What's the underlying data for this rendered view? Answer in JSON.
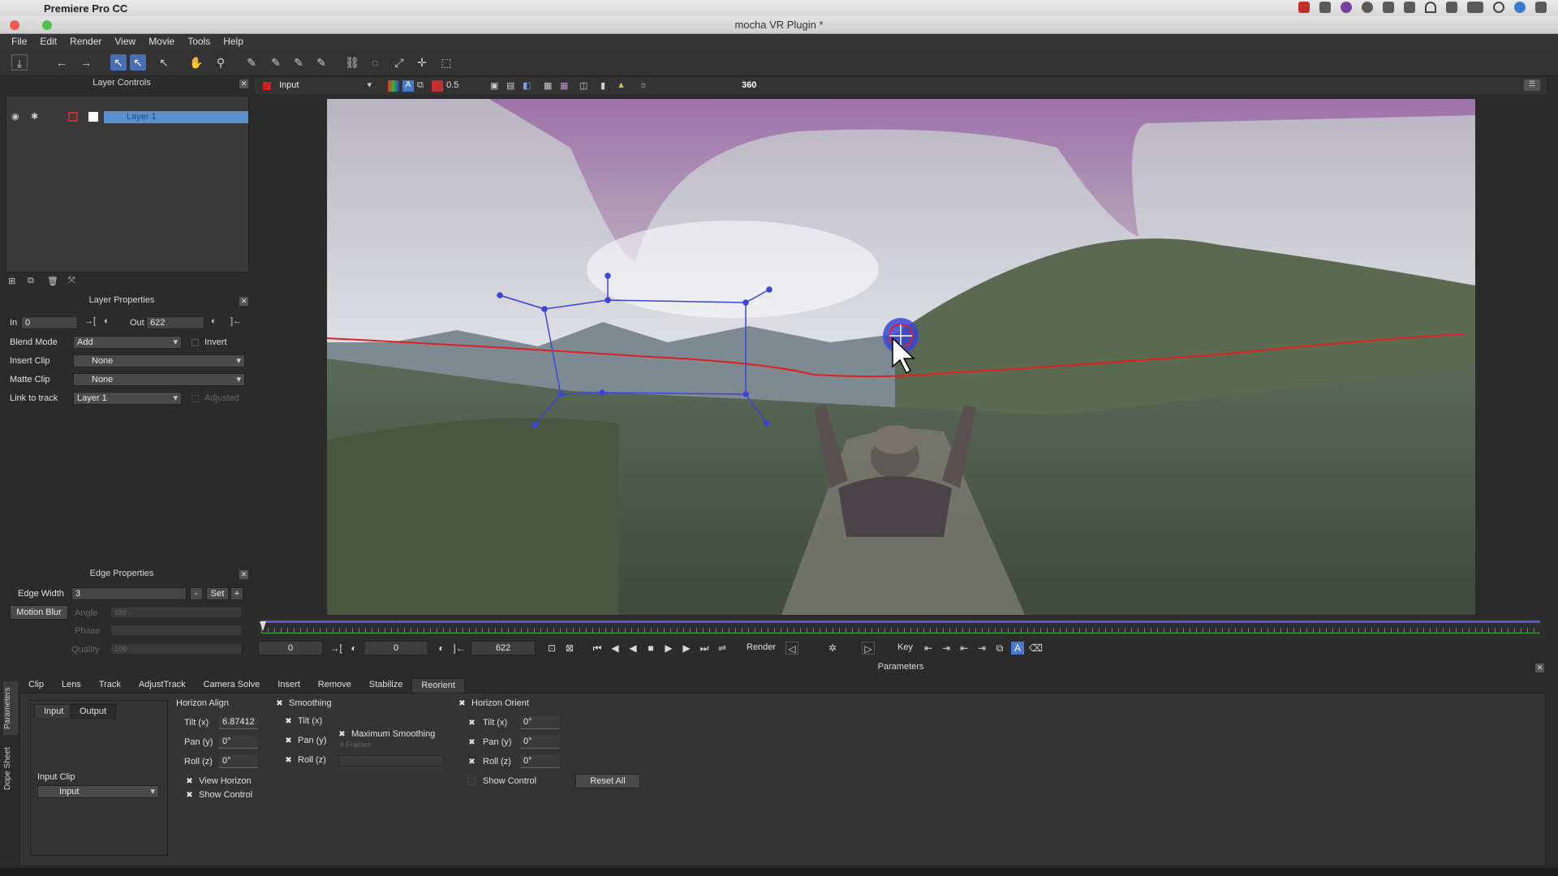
{
  "mac_menubar": {
    "app_name": "Premiere Pro CC"
  },
  "window": {
    "title": "mocha VR Plugin *"
  },
  "menu": [
    "File",
    "Edit",
    "Render",
    "View",
    "Movie",
    "Tools",
    "Help"
  ],
  "viewer_bar": {
    "clip": "Input",
    "zoom": "0.5",
    "mode": "360"
  },
  "layer_controls": {
    "title": "Layer Controls",
    "layers": [
      {
        "name": "Layer 1"
      }
    ]
  },
  "layer_properties": {
    "title": "Layer Properties",
    "in_label": "In",
    "in_value": "0",
    "out_label": "Out",
    "out_value": "622",
    "blend_mode_label": "Blend Mode",
    "blend_mode_value": "Add",
    "invert_label": "Invert",
    "insert_clip_label": "Insert Clip",
    "insert_clip_value": "None",
    "matte_clip_label": "Matte Clip",
    "matte_clip_value": "None",
    "link_to_track_label": "Link to track",
    "link_to_track_value": "Layer 1",
    "adjusted_label": "Adjusted"
  },
  "edge_properties": {
    "title": "Edge Properties",
    "edge_width_label": "Edge Width",
    "edge_width_value": "3",
    "minus": "-",
    "set": "Set",
    "plus": "+",
    "motion_blur_label": "Motion Blur",
    "angle_label": "Angle",
    "angle_value": "180",
    "phase_label": "Phase",
    "quality_label": "Quality",
    "quality_value": "100"
  },
  "transport": {
    "start": "0",
    "current": "0",
    "end": "622",
    "render_label": "Render",
    "key_label": "Key"
  },
  "parameters": {
    "title": "Parameters",
    "side_tabs": [
      "Parameters",
      "Dope Sheet"
    ],
    "tabs": [
      "Clip",
      "Lens",
      "Track",
      "AdjustTrack",
      "Camera Solve",
      "Insert",
      "Remove",
      "Stabilize",
      "Reorient"
    ],
    "io_tabs": [
      "Input",
      "Output"
    ],
    "input_clip_label": "Input Clip",
    "input_clip_value": "Input",
    "horizon_align": {
      "title": "Horizon Align",
      "tilt_label": "Tilt (x)",
      "tilt_value": "6.87412",
      "pan_label": "Pan (y)",
      "pan_value": "0°",
      "roll_label": "Roll (z)",
      "roll_value": "0°",
      "view_horizon": "View Horizon",
      "show_control": "Show Control"
    },
    "smoothing": {
      "title": "Smoothing",
      "tilt": "Tilt (x)",
      "pan": "Pan (y)",
      "roll": "Roll (z)",
      "max_smoothing": "Maximum Smoothing",
      "frames": "# Frames"
    },
    "horizon_orient": {
      "title": "Horizon Orient",
      "tilt_label": "Tilt (x)",
      "tilt_value": "0°",
      "pan_label": "Pan (y)",
      "pan_value": "0°",
      "roll_label": "Roll (z)",
      "roll_value": "0°",
      "show_control": "Show Control",
      "reset_all": "Reset All"
    }
  },
  "colors": {
    "accent_blue": "#4a6fb5",
    "layer_highlight": "#5a8fd0",
    "horizon_line": "#e02020",
    "spline": "#3a46d8",
    "timeline_blue": "#5a5ad8"
  }
}
